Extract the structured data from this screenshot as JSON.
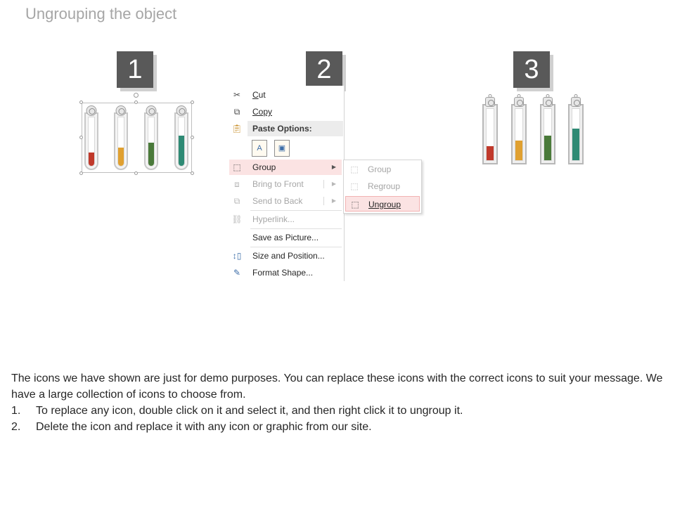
{
  "title": "Ungrouping the object",
  "steps": [
    "1",
    "2",
    "3"
  ],
  "tubes": {
    "colors": [
      "#c0392b",
      "#e0a030",
      "#4a7a3a",
      "#2e8a74"
    ],
    "fill_fractions": [
      0.28,
      0.38,
      0.48,
      0.62
    ]
  },
  "context_menu": {
    "cut": "Cut",
    "copy": "Copy",
    "paste_options": "Paste Options:",
    "group": "Group",
    "bring_to_front": "Bring to Front",
    "send_to_back": "Send to Back",
    "hyperlink": "Hyperlink...",
    "save_as_picture": "Save as Picture...",
    "size_and_position": "Size and Position...",
    "format_shape": "Format Shape..."
  },
  "submenu": {
    "group": "Group",
    "regroup": "Regroup",
    "ungroup": "Ungroup"
  },
  "description": {
    "intro": "The icons we have shown are just for demo purposes. You can replace these icons with the correct icons to suit your message. We have a large collection of icons to choose from.",
    "items": [
      {
        "num": "1.",
        "text": "To replace any icon, double click on it and select it, and then right click it to ungroup it."
      },
      {
        "num": "2.",
        "text": "Delete the icon and replace it with any icon or graphic from our site."
      }
    ]
  }
}
